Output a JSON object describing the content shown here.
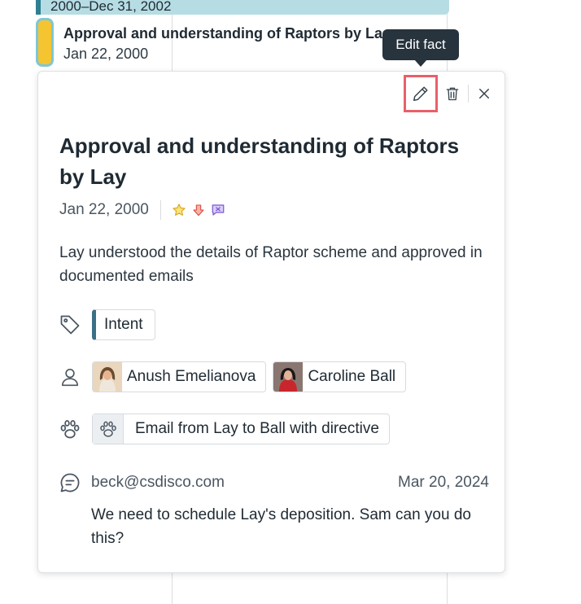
{
  "timeline": {
    "range_label": "2000–Dec 31, 2002",
    "fact_title": "Approval and understanding of Raptors by La",
    "fact_date": "Jan 22, 2000"
  },
  "tooltip": {
    "text": "Edit fact"
  },
  "card": {
    "title": "Approval and understanding of Raptors by Lay",
    "date": "Jan 22, 2000",
    "description": "Lay understood the details of Raptor scheme and approved in documented emails",
    "issue_tag": "Intent",
    "people": [
      {
        "name": "Anush Emelianova"
      },
      {
        "name": "Caroline Ball"
      }
    ],
    "evidence": "Email from Lay to Ball with directive",
    "comment": {
      "author": "beck@csdisco.com",
      "date": "Mar 20, 2024",
      "text": "We need to schedule Lay's deposition. Sam can you do this?"
    }
  },
  "icons": {
    "edit": "pencil-icon",
    "delete": "trash-icon",
    "close": "close-icon",
    "tag": "tag-icon",
    "person": "person-icon",
    "evidence": "paw-icon",
    "comment": "comment-icon",
    "star": "star-icon",
    "arrow_down": "arrow-down-icon",
    "flag": "chat-flag-icon"
  },
  "colors": {
    "highlight": "#e8606a",
    "tooltip_bg": "#27333d",
    "tag_bar": "#3b6f86",
    "fact_bar": "#f5c431",
    "range_bg": "#b6dde3"
  }
}
